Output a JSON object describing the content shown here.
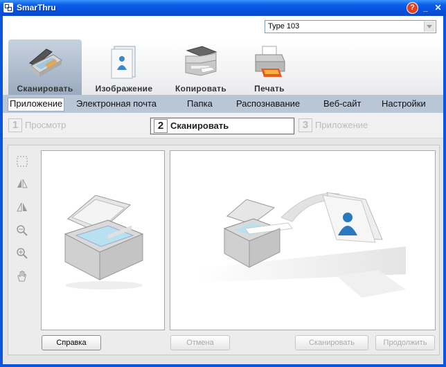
{
  "window": {
    "title": "SmarThru"
  },
  "title_buttons": {
    "help": "?",
    "minimize": "_",
    "close": "✕"
  },
  "device_select": {
    "value": "Type 103"
  },
  "toolbar": {
    "tools": [
      {
        "id": "scan",
        "label": "Сканировать",
        "icon": "scanner-icon",
        "active": true
      },
      {
        "id": "image",
        "label": "Изображение",
        "icon": "image-icon"
      },
      {
        "id": "copy",
        "label": "Копировать",
        "icon": "copier-icon"
      },
      {
        "id": "print",
        "label": "Печать",
        "icon": "printer-icon"
      }
    ]
  },
  "menu": {
    "items": [
      "Приложение",
      "Электронная почта",
      "Папка",
      "Распознавание",
      "Веб-сайт",
      "Настройки"
    ],
    "selected": "Приложение"
  },
  "steps": [
    {
      "num": "1",
      "label": "Просмотр"
    },
    {
      "num": "2",
      "label": "Сканировать"
    },
    {
      "num": "3",
      "label": "Приложение"
    }
  ],
  "buttons": {
    "help": "Справка",
    "cancel": "Отмена",
    "scan": "Сканировать",
    "continue": "Продолжить"
  },
  "colors": {
    "title_bar": "#0550dc",
    "active_tab": "#9aabbf",
    "menu_bar": "#b8c6d6"
  }
}
